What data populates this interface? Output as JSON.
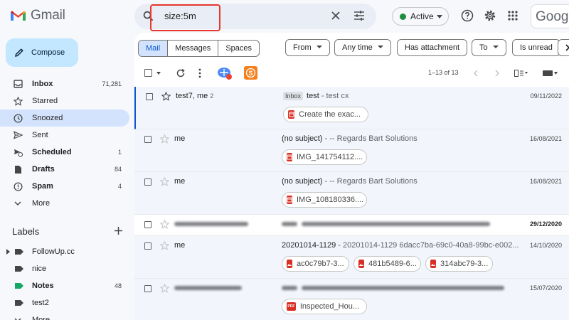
{
  "app": {
    "logo_text": "Gmail",
    "google_text": "Goog"
  },
  "search": {
    "query": "size:5m"
  },
  "status": {
    "label": "Active",
    "color": "#1e8e3e"
  },
  "compose": {
    "label": "Compose"
  },
  "nav": [
    {
      "label": "Inbox",
      "count": "71,281",
      "icon": "inbox-icon",
      "bold": true
    },
    {
      "label": "Starred",
      "count": "",
      "icon": "star-icon",
      "bold": false
    },
    {
      "label": "Snoozed",
      "count": "",
      "icon": "clock-icon",
      "bold": false,
      "selected": true
    },
    {
      "label": "Sent",
      "count": "",
      "icon": "send-icon",
      "bold": false
    },
    {
      "label": "Scheduled",
      "count": "1",
      "icon": "scheduled-icon",
      "bold": true
    },
    {
      "label": "Drafts",
      "count": "84",
      "icon": "draft-icon",
      "bold": true
    },
    {
      "label": "Spam",
      "count": "4",
      "icon": "spam-icon",
      "bold": true
    },
    {
      "label": "More",
      "count": "",
      "icon": "chevron-down-icon",
      "bold": false
    }
  ],
  "labels_section": {
    "title": "Labels"
  },
  "labels": [
    {
      "label": "FollowUp.cc",
      "count": "",
      "color": "#444746",
      "bold": false,
      "expandable": true
    },
    {
      "label": "nice",
      "count": "",
      "color": "#444746",
      "bold": false
    },
    {
      "label": "Notes",
      "count": "48",
      "color": "#16a765",
      "bold": true
    },
    {
      "label": "test2",
      "count": "",
      "color": "#444746",
      "bold": false
    },
    {
      "label": "More",
      "count": "",
      "color": "#444746",
      "bold": false
    }
  ],
  "chips": {
    "scope": [
      "Mail",
      "Messages",
      "Spaces"
    ],
    "filters": [
      "From",
      "Any time",
      "Has attachment",
      "To",
      "Is unread"
    ]
  },
  "toolbar": {
    "range": "1–13 of 13"
  },
  "emails": [
    {
      "sender": "test7, me",
      "thread_count": "2",
      "badge": "Inbox",
      "subject": "test",
      "snippet": " - test cx",
      "date": "09/11/2022",
      "attachments": [
        {
          "name": "Create the exac...",
          "type": "video"
        }
      ]
    },
    {
      "sender": "me",
      "thread_count": "",
      "badge": "",
      "subject": "(no subject)",
      "snippet": " - -- Regards Bart Solutions",
      "date": "16/08/2021",
      "attachments": [
        {
          "name": "IMG_141754112....",
          "type": "video"
        }
      ]
    },
    {
      "sender": "me",
      "thread_count": "",
      "badge": "",
      "subject": "(no subject)",
      "snippet": " - -- Regards Bart Solutions",
      "date": "16/08/2021",
      "attachments": [
        {
          "name": "IMG_108180336....",
          "type": "video"
        }
      ]
    },
    {
      "sender": "",
      "thread_count": "",
      "badge": "",
      "subject": "",
      "snippet": "",
      "date": "29/12/2020",
      "unread": true,
      "redacted": true,
      "attachments": []
    },
    {
      "sender": "me",
      "thread_count": "",
      "badge": "",
      "subject": "20201014-1129",
      "snippet": " - 20201014-1129 6dacc7ba-69c0-40a8-99bc-e002...",
      "date": "14/10/2020",
      "attachments": [
        {
          "name": "ac0c79b7-3...",
          "type": "image"
        },
        {
          "name": "481b5489-6...",
          "type": "image"
        },
        {
          "name": "314abc79-3...",
          "type": "image"
        }
      ]
    },
    {
      "sender": "",
      "thread_count": "",
      "badge": "",
      "subject": "",
      "snippet": "",
      "date": "15/07/2020",
      "redacted": true,
      "attachments": [
        {
          "name": "Inspected_Hou...",
          "type": "pdf"
        }
      ]
    }
  ],
  "colors": {
    "accent": "#0b57d0",
    "compose_bg": "#c2e7ff",
    "selected_nav": "#d3e3fd",
    "highlight_box": "#e8372e"
  }
}
